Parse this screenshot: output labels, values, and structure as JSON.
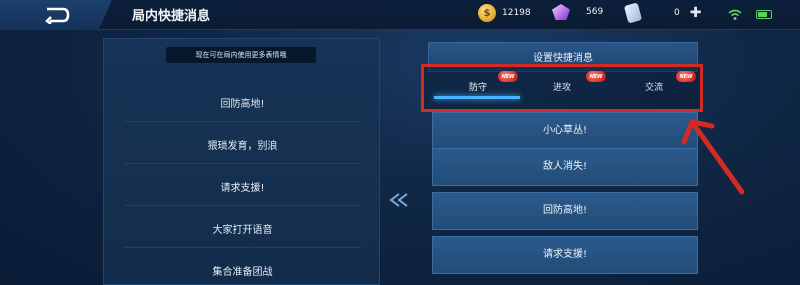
{
  "header": {
    "title": "局内快捷消息",
    "gold": "12198",
    "gems": "569",
    "tickets": "0"
  },
  "left_panel": {
    "hint": "现在可在局内使用更多表情哦",
    "items": [
      "回防高地!",
      "猥琐发育，别浪",
      "请求支援!",
      "大家打开语音",
      "集合准备团战"
    ]
  },
  "right_panel": {
    "header": "设置快捷消息",
    "tabs": [
      {
        "label": "防守",
        "badge": "NEW",
        "active": true
      },
      {
        "label": "进攻",
        "badge": "NEW",
        "active": false
      },
      {
        "label": "交流",
        "badge": "NEW",
        "active": false
      }
    ],
    "items": [
      "小心草丛!",
      "敌人消失!",
      "回防高地!",
      "请求支援!"
    ]
  },
  "colors": {
    "highlight_box": "#d32a24",
    "tab_underline": "#4ab3ff"
  }
}
